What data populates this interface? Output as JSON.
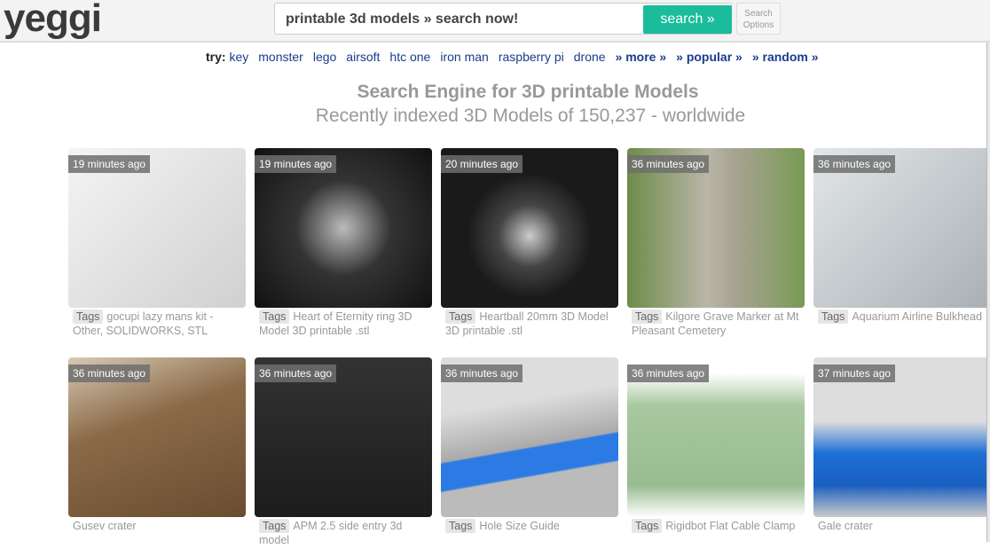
{
  "header": {
    "logo": "yeggi",
    "search_value": "printable 3d models » search now!",
    "search_button": "search »",
    "options_line1": "Search",
    "options_line2": "Options"
  },
  "try": {
    "label": "try:",
    "links": [
      "key",
      "monster",
      "lego",
      "airsoft",
      "htc one",
      "iron man",
      "raspberry pi",
      "drone"
    ],
    "specials": [
      "» more »",
      "» popular »",
      "» random »"
    ]
  },
  "headings": {
    "title": "Search Engine for 3D printable Models",
    "subtitle": "Recently indexed 3D Models of 150,237 - worldwide"
  },
  "tag_label": "Tags",
  "cards": [
    {
      "time": "19 minutes ago",
      "title": "gocupi lazy mans kit - Other, SOLIDWORKS, STL",
      "tags": true,
      "bg": "#e8e8e8"
    },
    {
      "time": "19 minutes ago",
      "title": "Heart of Eternity ring 3D Model 3D printable .stl",
      "tags": true,
      "bg": "#1a1a1a"
    },
    {
      "time": "20 minutes ago",
      "title": "Heartball 20mm 3D Model 3D printable .stl",
      "tags": true,
      "bg": "#202020"
    },
    {
      "time": "36 minutes ago",
      "title": "Kilgore Grave Marker at Mt Pleasant Cemetery",
      "tags": true,
      "bg": "#7d9a5a"
    },
    {
      "time": "36 minutes ago",
      "title": "Aquarium Airline Bulkhead",
      "tags": true,
      "bg": "#c9ced2"
    },
    {
      "time": "36 minutes ago",
      "title": "Gusev crater",
      "tags": false,
      "bg": "#8a6a48"
    },
    {
      "time": "36 minutes ago",
      "title": "APM 2.5 side entry 3d model",
      "tags": true,
      "bg": "#2a2a2a"
    },
    {
      "time": "36 minutes ago",
      "title": "Hole Size Guide",
      "tags": true,
      "bg": "#b8b8b8"
    },
    {
      "time": "36 minutes ago",
      "title": "Rigidbot Flat Cable Clamp",
      "tags": true,
      "bg": "#f4f6f2"
    },
    {
      "time": "37 minutes ago",
      "title": "Gale crater",
      "tags": false,
      "bg": "#c4c4c4"
    }
  ]
}
